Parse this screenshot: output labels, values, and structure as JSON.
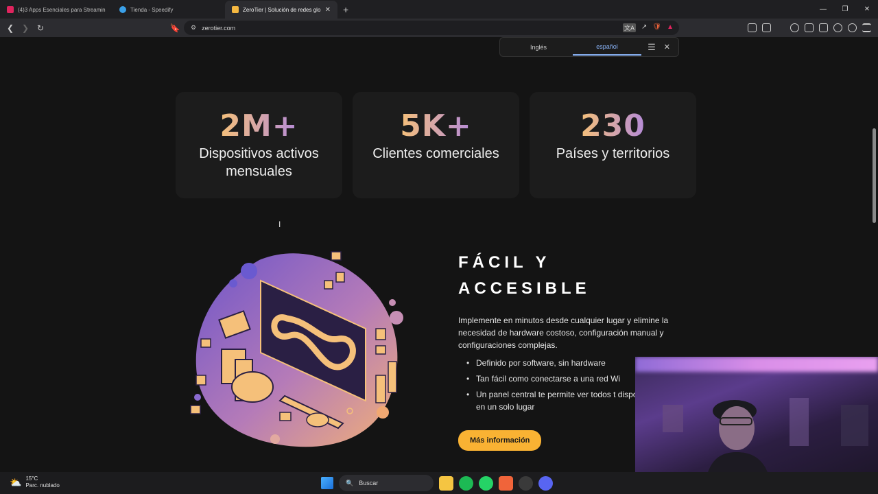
{
  "browser": {
    "tabs": [
      {
        "title": "(4)3 Apps Esenciales para Streaming",
        "color": "#e0245e"
      },
      {
        "title": "Tienda - Speedify",
        "color": "#3aa0e8"
      },
      {
        "title": "ZeroTier | Solución de redes glo",
        "color": "#f5b841"
      }
    ],
    "new_tab": "+",
    "url": "zerotier.com",
    "window_controls": [
      "—",
      "❐",
      "✕"
    ]
  },
  "translate_bar": {
    "source": "Inglés",
    "target": "español",
    "menu": "☰",
    "close": "✕"
  },
  "stats": [
    {
      "number": "2M+",
      "label": "Dispositivos activos mensuales"
    },
    {
      "number": "5K+",
      "label": "Clientes comerciales"
    },
    {
      "number": "230",
      "label": "Países y territorios"
    }
  ],
  "feature": {
    "title_line1": "FÁCIL Y",
    "title_line2": "ACCESIBLE",
    "description": "Implemente en minutos desde cualquier lugar y elimine la necesidad de hardware costoso, configuración manual y configuraciones complejas.",
    "bullets": [
      "Definido por software, sin hardware",
      "Tan fácil como conectarse a una red Wi",
      "Un panel central te permite ver todos t dispositivos y redes en un solo lugar"
    ],
    "button": "Más información"
  },
  "taskbar": {
    "temperature": "15°C",
    "weather_desc": "Parc. nublado",
    "search_placeholder": "Buscar"
  },
  "colors": {
    "accent_button": "#f9b233",
    "gradient_start": "#f5c07a",
    "gradient_end": "#b58bd8",
    "page_bg": "#141414",
    "card_bg": "#1c1c1c"
  }
}
